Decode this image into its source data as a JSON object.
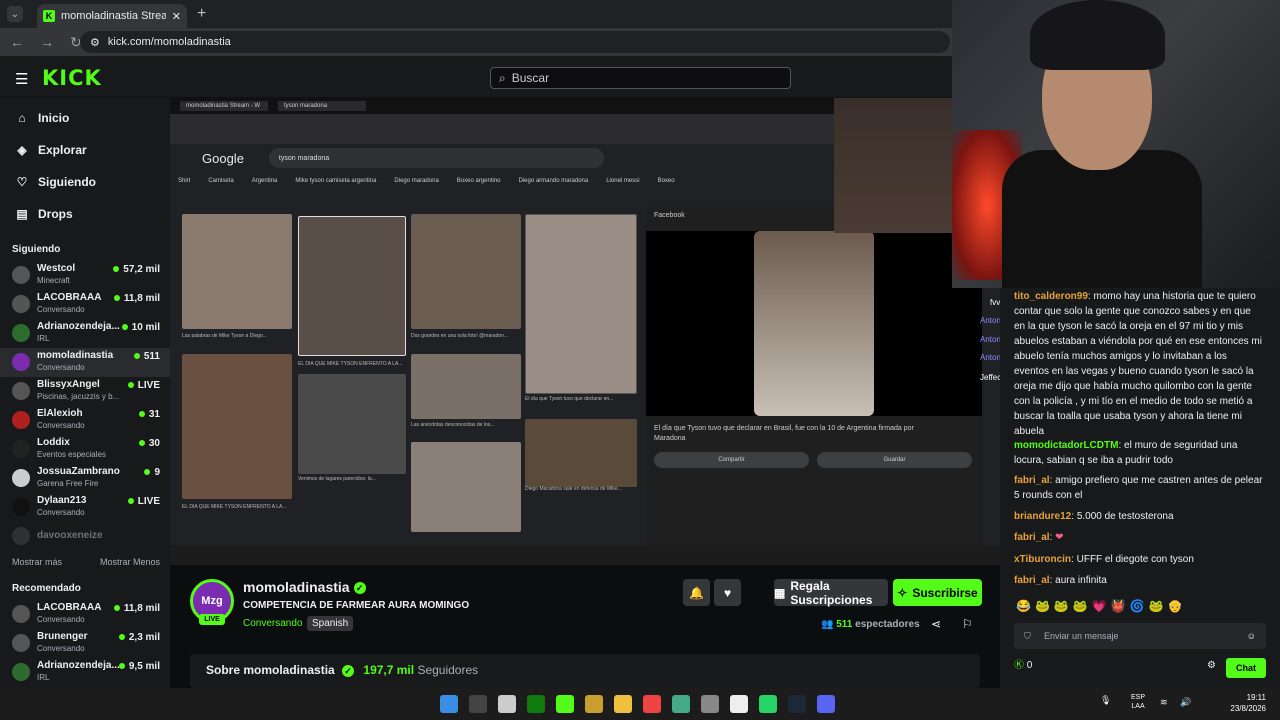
{
  "browser": {
    "tab_title": "momoladinastia Stream - W",
    "tab_favicon": "K",
    "url": "kick.com/momoladinastia"
  },
  "header": {
    "logo": "KICK",
    "search_placeholder": "Buscar"
  },
  "sidebar": {
    "nav": [
      {
        "label": "Inicio",
        "icon": "home-icon"
      },
      {
        "label": "Explorar",
        "icon": "compass-icon"
      },
      {
        "label": "Siguiendo",
        "icon": "heart-icon"
      },
      {
        "label": "Drops",
        "icon": "drops-icon"
      }
    ],
    "following_title": "Siguiendo",
    "following": [
      {
        "name": "Westcol",
        "sub": "Minecraft",
        "viewers": "57,2 mil"
      },
      {
        "name": "LACOBRAAA",
        "sub": "Conversando",
        "viewers": "11,8 mil"
      },
      {
        "name": "Adrianozendeja...",
        "sub": "IRL",
        "viewers": "10 mil"
      },
      {
        "name": "momoladinastia",
        "sub": "Conversando",
        "viewers": "511"
      },
      {
        "name": "BlissyxAngel",
        "sub": "Piscinas, jacuzzis y b...",
        "viewers": "LIVE"
      },
      {
        "name": "ElAlexioh",
        "sub": "Conversando",
        "viewers": "31"
      },
      {
        "name": "Loddix",
        "sub": "Eventos especiales",
        "viewers": "30"
      },
      {
        "name": "JossuaZambrano",
        "sub": "Garena Free Fire",
        "viewers": "9"
      },
      {
        "name": "Dylaan213",
        "sub": "Conversando",
        "viewers": "LIVE"
      },
      {
        "name": "davooxeneize",
        "sub": "",
        "viewers": ""
      }
    ],
    "show_more": "Mostrar más",
    "show_less": "Mostrar Menos",
    "recommended_title": "Recomendado",
    "recommended": [
      {
        "name": "LACOBRAAA",
        "sub": "Conversando",
        "viewers": "11,8 mil"
      },
      {
        "name": "Brunenger",
        "sub": "Conversando",
        "viewers": "2,3 mil"
      },
      {
        "name": "Adrianozendeja...",
        "sub": "IRL",
        "viewers": "9,5 mil"
      }
    ]
  },
  "stream_view": {
    "search_query": "tyson maradona",
    "google_logo": "Google",
    "chips": [
      "Shirt",
      "Camiseta",
      "Argentina",
      "Mike tyson camiseta argentina",
      "Diego maradona",
      "Boxeo argentino",
      "Diego armando maradona",
      "Lionel messi",
      "Boxeo"
    ],
    "captions": [
      "Las palabras de Mike Tyson a Diego...",
      "EL DÍA QUE MIKE TYSON ENFRENTÓ A LA...",
      "Dos grandes en una sola foto! @maradon...",
      "El día que Tyson tuvo que declarar en...",
      "Las anécdotas desconocidas de los...",
      "Venimos de lugares parecidos: la...",
      "Diego Maradona sale en defensa de Mike...",
      "EL DÍA QUE MIKE TYSON ENFRENTÓ A LA..."
    ],
    "preview_source": "Facebook",
    "preview_caption": "El día que Tyson tuvo que declarar en Brasil, fue con la 10 de Argentina firmada por Maradona",
    "share_label": "Compartir",
    "save_label": "Guardar"
  },
  "channel": {
    "avatar_text": "Mzg",
    "live_badge": "LIVE",
    "name": "momoladinastia",
    "title": "COMPETENCIA DE FARMEAR AURA MOMINGO",
    "category": "Conversando",
    "language": "Spanish",
    "gift_label": "Regala Suscripciones",
    "subscribe_label": "Suscribirse",
    "viewers": "511",
    "viewers_label": "espectadores",
    "about_label": "Sobre momoladinastia",
    "followers": "197,7 mil",
    "followers_label": "Seguidores"
  },
  "overlay_names": [
    "fvvzz",
    "AntonyM",
    "AntonyM",
    "AntonyM",
    "Jeffecuador"
  ],
  "chat": {
    "messages": [
      {
        "user": "tito_calderon99",
        "text": "momo hay una historia que te quiero contar que solo la gente que conozco sabes y en que en la que tyson le sacó la oreja en el 97 mi tio y mis abuelos estaban a viéndola por qué en ese entonces mi abuelo tenía muchos amigos y lo invitaban a los eventos en las vegas y bueno cuando tyson le sacó la oreja me dijo que había mucho quilombo con la gente con la policía , y mi tío en el medio de todo se metió a buscar la toalla que usaba tyson y ahora la tiene mi abuela",
        "color": "#e8a23a"
      },
      {
        "user": "momodictadorLCDTM",
        "text": "el muro de seguridad una locura, sabian q se iba a pudrir todo",
        "color": "#53fc18"
      },
      {
        "user": "fabri_al",
        "text": "amigo prefiero que me castren antes de pelear 5 rounds con el",
        "color": "#e8a23a"
      },
      {
        "user": "briandure12",
        "text": "5.000 de testosterona",
        "color": "#e8a23a"
      },
      {
        "user": "fabri_al",
        "text": "❤",
        "color": "#e8a23a"
      },
      {
        "user": "xTiburoncin",
        "text": "UFFF el diegote con tyson",
        "color": "#e8a23a"
      },
      {
        "user": "fabri_al",
        "text": "aura infinita",
        "color": "#e8a23a"
      }
    ],
    "emotes": "😂🐸🐸🐸💗👹🌀🐸👴",
    "input_placeholder": "Enviar un mensaje",
    "points": "0",
    "send_label": "Chat"
  },
  "taskbar": {
    "lang_top": "ESP",
    "lang_bottom": "LAA",
    "time": "19:11",
    "date": "23/8/2026"
  },
  "colors": {
    "accent": "#53fc18",
    "bg": "#0b0e0f",
    "panel": "#18191b"
  }
}
